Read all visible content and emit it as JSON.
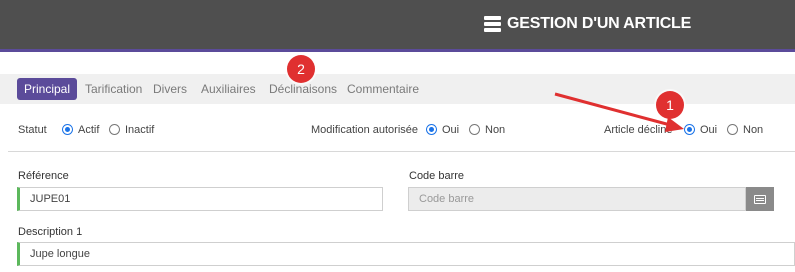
{
  "header": {
    "title": "GESTION D'UN ARTICLE",
    "icon": "server-stack-icon"
  },
  "tabs": [
    {
      "label": "Principal",
      "active": true
    },
    {
      "label": "Tarification"
    },
    {
      "label": "Divers"
    },
    {
      "label": "Auxiliaires"
    },
    {
      "label": "Déclinaisons"
    },
    {
      "label": "Commentaire"
    }
  ],
  "annotations": {
    "badge1": "1",
    "badge2": "2",
    "accent_color": "#e03030"
  },
  "statut": {
    "label": "Statut",
    "opt1": "Actif",
    "opt2": "Inactif",
    "selected": "Actif"
  },
  "modification": {
    "label": "Modification autorisée",
    "opt1": "Oui",
    "opt2": "Non",
    "selected": "Oui"
  },
  "decline": {
    "label": "Article décliné",
    "opt1": "Oui",
    "opt2": "Non",
    "selected": "Oui"
  },
  "fields": {
    "reference": {
      "label": "Référence",
      "value": "JUPE01"
    },
    "code_barre": {
      "label": "Code barre",
      "placeholder": "Code barre"
    },
    "description": {
      "label": "Description 1",
      "value": "Jupe longue"
    }
  },
  "colors": {
    "primary": "#5b4b9a",
    "required": "#5cb85c",
    "header_bg": "#4f4f4f"
  }
}
